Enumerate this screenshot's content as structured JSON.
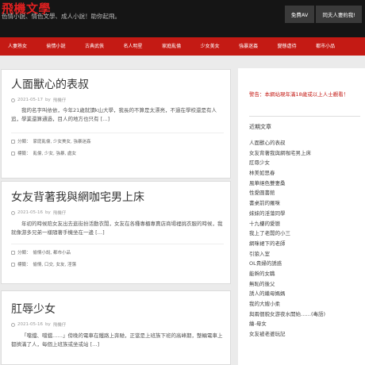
{
  "site": {
    "title": "飛機文學",
    "description": "色情小說、情色文學、成人小說！助你起飛。",
    "top_links": [
      "免費AV",
      "同夫人妻約我!"
    ]
  },
  "nav": [
    "人妻熟女",
    "偷情小說",
    "古典武俠",
    "名人明星",
    "家庭亂倫",
    "少女美女",
    "強暴迷姦",
    "變態虐待",
    "都市小品"
  ],
  "posts": [
    {
      "title": "人面獸心的表叔",
      "date": "2021-05-17",
      "by": "by",
      "author": "飛機仔",
      "excerpt": "我的名字叫依依，今年21歲就讀k山大學，我長的不算是太漂亮，不過在學校還是有人追，學業還算通過，目人的地方也只有 […]",
      "categories_label": "分類：",
      "categories": "家庭亂倫, 少女美女, 強暴迷姦",
      "tags_label": "標籤：",
      "tags": "亂倫, 少女, 強暴, 處女"
    },
    {
      "title": "女友背著我與網咖宅男上床",
      "date": "2021-05-16",
      "by": "by",
      "author": "飛機仔",
      "excerpt": "年初的時候陪女友出去逛街扮活動衣閒，女友在各種專櫃專賣店商場裡挑衣服的時候，我就像游多兄弟一樣隨著手機坐在一邊 […]",
      "categories_label": "分類：",
      "categories": "偷情小說, 都市小品",
      "tags_label": "標籤：",
      "tags": "偷情, 口交, 女友, 淫蕩"
    },
    {
      "title": "肛辱少女",
      "date": "2021-05-16",
      "by": "by",
      "author": "飛機仔",
      "excerpt": "「噹鐺、噹鐺……」傍晚的電車在鐵路上奔馳，正當是上班族下班的高峰期，整輛電車上都擠滿了人，每個上班族或坐或站 […]"
    }
  ],
  "sidebar": {
    "notice": "警告：本網站現年滿18歲或以上人士觀看！",
    "recent_heading": "近期文章",
    "recent_posts": [
      "人面獸心的表叔",
      "女友背著我與網咖宅男上床",
      "肛辱少女",
      "林美如思春",
      "風華絕色雙妻桑",
      "性愛圓書館",
      "書桌前的羅咪",
      "妹妹的淫蕩同學",
      "十九樓的愛戀",
      "我上了老闆的小三",
      "網咪裙下的老師",
      "引狼入室",
      "OL貴婦的誘惑",
      "能幹的女職",
      "無恥的後父",
      "誘人的繼母媽媽",
      "我的大嫂小柔",
      "與兩個貌女游夜水開始……(毒語)",
      "繪-母女",
      "女友被老婆玩記"
    ]
  }
}
